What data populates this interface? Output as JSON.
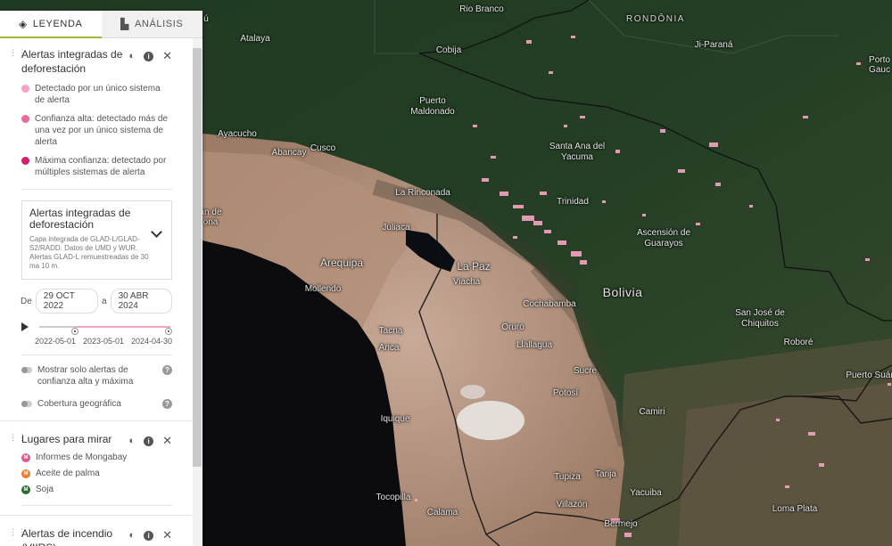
{
  "tabs": [
    {
      "label": "LEYENDA",
      "icon": "layers-icon",
      "active": true
    },
    {
      "label": "ANÁLISIS",
      "icon": "bar-chart-icon",
      "active": false
    }
  ],
  "colors": {
    "accent": "#97be32",
    "alert_single": "#f6a3c4",
    "alert_high": "#ec6a9a",
    "alert_max": "#d6206b",
    "mongabay": "#e3548f",
    "palm_oil": "#ef7a2c",
    "soy": "#2d6a2d"
  },
  "layer_alerts": {
    "title": "Alertas integradas de deforestación",
    "legend": [
      "Detectado por un único sistema de alerta",
      "Confianza alta: detectado más de una vez por un único sistema de alerta",
      "Máxima confianza: detectado por múltiples sistemas de alerta"
    ],
    "box_title": "Alertas integradas de deforestación",
    "box_desc": "Capa integrada de GLAD-L/GLAD-S2/RADD. Datos de UMD y WUR. Alertas GLAD-L remuestreadas de 30 ma 10 m.",
    "date_from_label": "De",
    "date_from": "29 OCT 2022",
    "date_sep": "a",
    "date_to": "30 ABR 2024",
    "timeline_ticks": [
      "2022-05-01",
      "2023-05-01",
      "2024-04-30"
    ],
    "timeline_start_fraction": 0.27,
    "timeline_end_fraction": 1.0,
    "toggle_confidence": "Mostrar solo alertas de confianza alta y máxima",
    "toggle_coverage": "Cobertura geográfica"
  },
  "layer_places": {
    "title": "Lugares para mirar",
    "items": [
      "Informes de Mongabay",
      "Aceite de palma",
      "Soja"
    ]
  },
  "layer_fire": {
    "title": "Alertas de incendio (VIIRS)"
  },
  "map_labels": [
    {
      "text": "Rio Branco",
      "kind": "city"
    },
    {
      "text": "RONDÔNIA",
      "kind": "region"
    },
    {
      "text": "Ji-Paraná",
      "kind": "city"
    },
    {
      "text": "Porto",
      "kind": "city"
    },
    {
      "text": "Gauc",
      "kind": "city"
    },
    {
      "text": "Atalaya",
      "kind": "city"
    },
    {
      "text": "Cobija",
      "kind": "city"
    },
    {
      "text": "Puerto Maldonado",
      "kind": "city"
    },
    {
      "text": "Ayacucho",
      "kind": "city"
    },
    {
      "text": "Abancay",
      "kind": "city"
    },
    {
      "text": "Cusco",
      "kind": "city"
    },
    {
      "text": "Santa Ana del Yacuma",
      "kind": "city"
    },
    {
      "text": "La Rinconada",
      "kind": "city"
    },
    {
      "text": "Juliaca",
      "kind": "city"
    },
    {
      "text": "Trinidad",
      "kind": "city"
    },
    {
      "text": "Ascensión de Guarayos",
      "kind": "city"
    },
    {
      "text": "an de",
      "kind": "city"
    },
    {
      "text": "ona",
      "kind": "city"
    },
    {
      "text": "Arequipa",
      "kind": "mid"
    },
    {
      "text": "La Paz",
      "kind": "mid"
    },
    {
      "text": "Viacha",
      "kind": "city"
    },
    {
      "text": "Mollendo",
      "kind": "city"
    },
    {
      "text": "Bolivia",
      "kind": "country"
    },
    {
      "text": "Cochabamba",
      "kind": "city"
    },
    {
      "text": "San José de Chiquitos",
      "kind": "city"
    },
    {
      "text": "Oruro",
      "kind": "city"
    },
    {
      "text": "Tacna",
      "kind": "city"
    },
    {
      "text": "Llallagua",
      "kind": "city"
    },
    {
      "text": "Arica",
      "kind": "city"
    },
    {
      "text": "Roboré",
      "kind": "city"
    },
    {
      "text": "Sucre",
      "kind": "city"
    },
    {
      "text": "Puerto Suár",
      "kind": "city"
    },
    {
      "text": "Potosí",
      "kind": "city"
    },
    {
      "text": "Iquique",
      "kind": "city"
    },
    {
      "text": "Camiri",
      "kind": "city"
    },
    {
      "text": "Tarija",
      "kind": "city"
    },
    {
      "text": "Tupiza",
      "kind": "city"
    },
    {
      "text": "Yacuiba",
      "kind": "city"
    },
    {
      "text": "Tocopilla",
      "kind": "city"
    },
    {
      "text": "Villazón",
      "kind": "city"
    },
    {
      "text": "Calama",
      "kind": "city"
    },
    {
      "text": "Loma Plata",
      "kind": "city"
    },
    {
      "text": "Bermejo",
      "kind": "city"
    },
    {
      "text": "ú",
      "kind": "city"
    }
  ]
}
